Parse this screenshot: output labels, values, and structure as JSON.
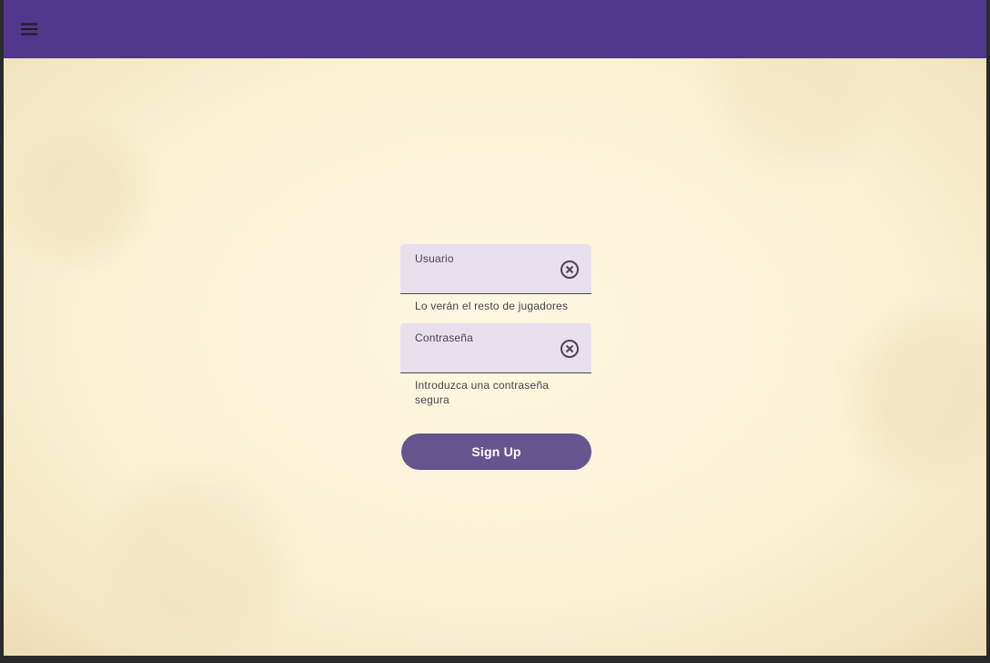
{
  "app_bar": {
    "menu_icon": "menu-icon",
    "color": "#4f378b"
  },
  "form": {
    "username": {
      "label": "Usuario",
      "value": "",
      "helper": "Lo verán el resto de jugadores",
      "clear_icon": "clear-circle-icon"
    },
    "password": {
      "label": "Contraseña",
      "value": "",
      "helper": "Introduzca una contraseña segura",
      "clear_icon": "clear-circle-icon"
    },
    "submit_label": "Sign Up",
    "submit_color": "#65558f"
  }
}
